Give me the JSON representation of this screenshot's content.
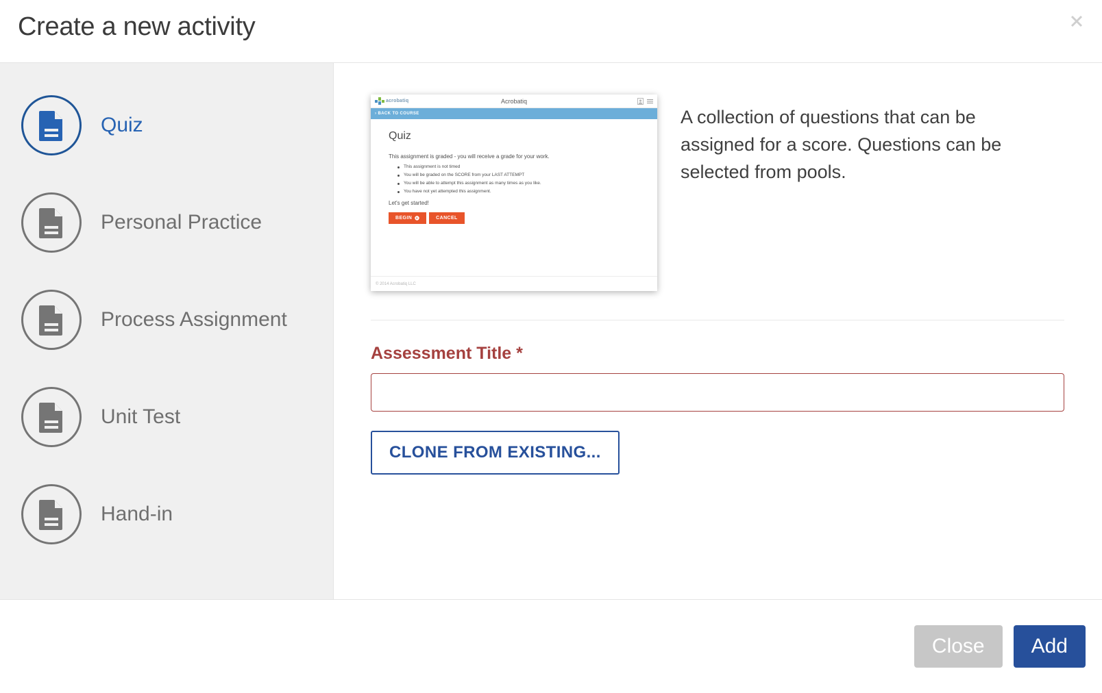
{
  "header": {
    "title": "Create a new activity",
    "close_icon": "close-icon"
  },
  "sidebar": {
    "items": [
      {
        "label": "Quiz",
        "icon": "document-icon",
        "selected": true
      },
      {
        "label": "Personal Practice",
        "icon": "document-icon",
        "selected": false
      },
      {
        "label": "Process Assignment",
        "icon": "document-icon",
        "selected": false
      },
      {
        "label": "Unit Test",
        "icon": "document-icon",
        "selected": false
      },
      {
        "label": "Hand-in",
        "icon": "document-icon",
        "selected": false
      }
    ]
  },
  "main": {
    "description": "A collection of questions that can be assigned for a score. Questions can be selected from pools.",
    "preview": {
      "logo_text": "acrobatiq",
      "app_title": "Acrobatiq",
      "back_link": "› BACK TO COURSE",
      "heading": "Quiz",
      "lead": "This assignment is graded - you will receive a grade for your work.",
      "bullets": [
        "This assignment is not timed",
        "You will be graded on the SCORE from your LAST ATTEMPT",
        "You will be able to attempt this assignment as many times as you like.",
        "You have not yet attempted this assignment."
      ],
      "lets_get_started": "Let's get started!",
      "begin_label": "BEGIN",
      "cancel_label": "CANCEL",
      "footer": "© 2014 Acrobatiq LLC"
    },
    "form": {
      "title_label": "Assessment Title",
      "required_mark": "*",
      "title_value": "",
      "title_placeholder": "",
      "clone_label": "CLONE FROM EXISTING..."
    }
  },
  "footer": {
    "close_label": "Close",
    "add_label": "Add"
  },
  "colors": {
    "accent_blue": "#27509b",
    "selected_blue": "#2763b3",
    "required_red": "#a5413f",
    "orange": "#e8542a",
    "preview_bar_blue": "#6caed9",
    "sidebar_bg": "#f0f0f0",
    "close_gray": "#c7c7c7"
  }
}
